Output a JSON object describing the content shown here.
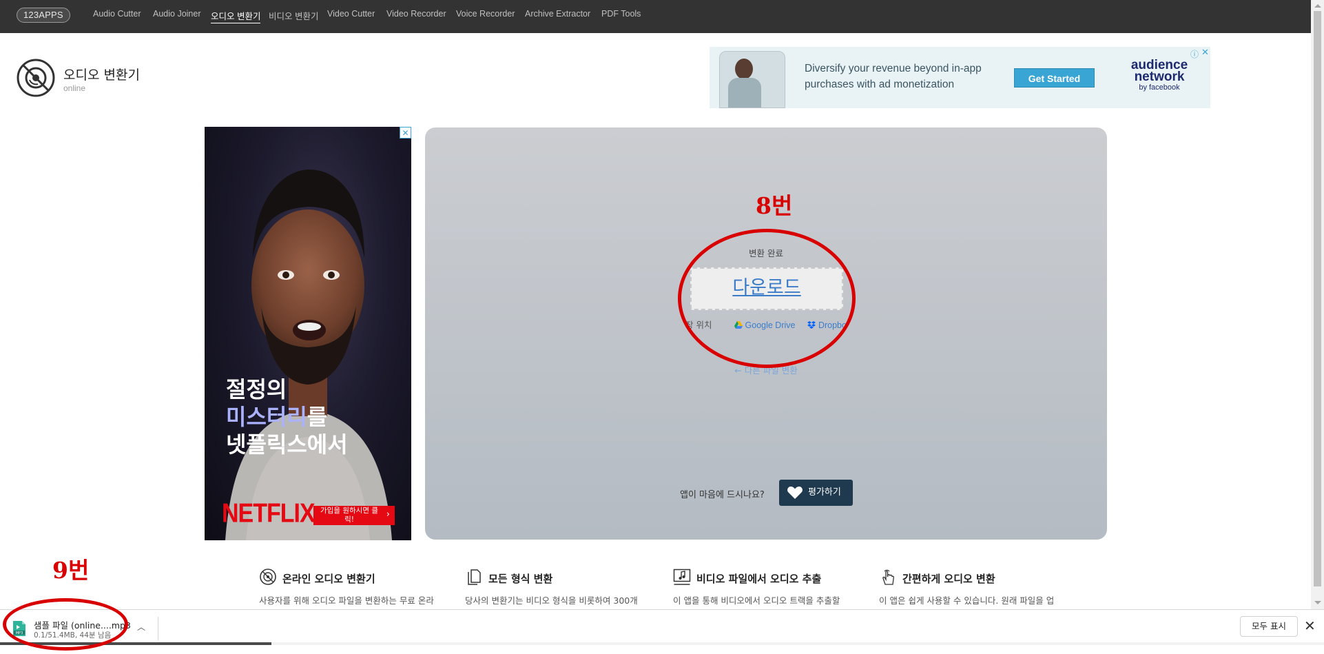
{
  "nav": {
    "brand": "123APPS",
    "links": [
      "Audio Cutter",
      "Audio Joiner",
      "오디오 변환기",
      "비디오 변환기",
      "Video Cutter",
      "Video Recorder",
      "Voice Recorder",
      "Archive Extractor",
      "PDF Tools"
    ],
    "active_index": 2
  },
  "app": {
    "title": "오디오 변환기",
    "subtitle": "online"
  },
  "ad_top": {
    "text": "Diversify your revenue beyond in-app purchases with ad monetization",
    "cta": "Get Started",
    "brand_main": "audience network",
    "brand_sub": "by facebook"
  },
  "ad_side": {
    "line1": "절정의",
    "line2_highlight": "미스터리",
    "line2_rest": "를",
    "line3": "넷플릭스에서",
    "logo": "NETFLIX",
    "cta": "가입을 원하시면 클릭!"
  },
  "panel": {
    "status": "변환 완료",
    "download": "다운로드",
    "save_label": "장 위치",
    "save_services": [
      "Google Drive",
      "Dropbo"
    ],
    "back_link": "← 다른 파일 변환",
    "rate_question": "앱이 마음에 드시나요?",
    "rate_button": "평가하기"
  },
  "annotations": {
    "step8": "8번",
    "step9": "9번"
  },
  "features": [
    {
      "icon": "disc-icon",
      "title": "온라인 오디오 변환기",
      "desc": "사용자를 위해 오디오 파일을 변환하는 무료 온라"
    },
    {
      "icon": "files-icon",
      "title": "모든 형식 변환",
      "desc": "당사의 변환기는 비디오 형식을 비롯하여 300개"
    },
    {
      "icon": "music-note-icon",
      "title": "비디오 파일에서 오디오 추출",
      "desc": "이 앱을 통해 비디오에서 오디오 트랙을 추출할"
    },
    {
      "icon": "hand-pointer-icon",
      "title": "간편하게 오디오 변환",
      "desc": "이 앱은 쉽게 사용할 수 있습니다. 원래 파일을 업"
    }
  ],
  "download_shelf": {
    "file_name": "샘플 파일 (online....mp3",
    "status": "0.1/51.4MB, 44분 남음",
    "progress_fraction": 0.0019,
    "show_all": "모두 표시",
    "close": "✕"
  }
}
